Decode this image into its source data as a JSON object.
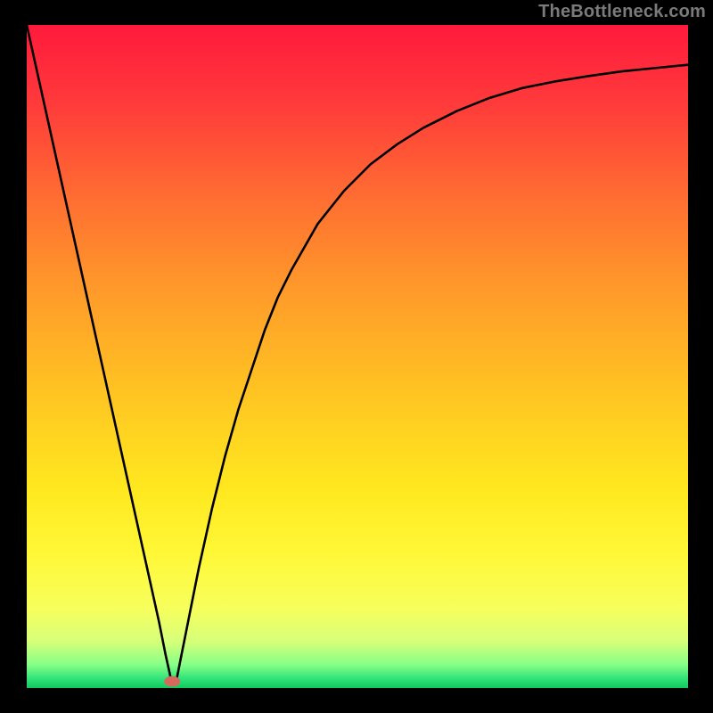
{
  "watermark": "TheBottleneck.com",
  "chart_data": {
    "type": "line",
    "title": "",
    "xlabel": "",
    "ylabel": "",
    "xlim": [
      0,
      100
    ],
    "ylim": [
      0,
      100
    ],
    "marker": {
      "x": 22,
      "y": 1.0
    },
    "curve": [
      {
        "x": 0,
        "y": 100
      },
      {
        "x": 2,
        "y": 91
      },
      {
        "x": 4,
        "y": 82
      },
      {
        "x": 6,
        "y": 73
      },
      {
        "x": 8,
        "y": 64
      },
      {
        "x": 10,
        "y": 55
      },
      {
        "x": 12,
        "y": 46
      },
      {
        "x": 14,
        "y": 37
      },
      {
        "x": 16,
        "y": 28
      },
      {
        "x": 18,
        "y": 19
      },
      {
        "x": 20,
        "y": 10
      },
      {
        "x": 21,
        "y": 5
      },
      {
        "x": 22,
        "y": 0.5
      },
      {
        "x": 22.5,
        "y": 0.5
      },
      {
        "x": 23,
        "y": 3
      },
      {
        "x": 24,
        "y": 8
      },
      {
        "x": 25,
        "y": 13
      },
      {
        "x": 26,
        "y": 18
      },
      {
        "x": 28,
        "y": 27
      },
      {
        "x": 30,
        "y": 35
      },
      {
        "x": 32,
        "y": 42
      },
      {
        "x": 34,
        "y": 48
      },
      {
        "x": 36,
        "y": 54
      },
      {
        "x": 38,
        "y": 59
      },
      {
        "x": 40,
        "y": 63
      },
      {
        "x": 44,
        "y": 70
      },
      {
        "x": 48,
        "y": 75
      },
      {
        "x": 52,
        "y": 79
      },
      {
        "x": 56,
        "y": 82
      },
      {
        "x": 60,
        "y": 84.5
      },
      {
        "x": 65,
        "y": 87
      },
      {
        "x": 70,
        "y": 89
      },
      {
        "x": 75,
        "y": 90.5
      },
      {
        "x": 80,
        "y": 91.5
      },
      {
        "x": 85,
        "y": 92.3
      },
      {
        "x": 90,
        "y": 93
      },
      {
        "x": 95,
        "y": 93.5
      },
      {
        "x": 100,
        "y": 94
      }
    ],
    "gradient_stops": [
      {
        "offset": 0.0,
        "color": "#ff1a3c"
      },
      {
        "offset": 0.12,
        "color": "#ff3b3b"
      },
      {
        "offset": 0.25,
        "color": "#ff6a32"
      },
      {
        "offset": 0.4,
        "color": "#ff9a2a"
      },
      {
        "offset": 0.55,
        "color": "#ffc322"
      },
      {
        "offset": 0.7,
        "color": "#ffe81f"
      },
      {
        "offset": 0.8,
        "color": "#fff838"
      },
      {
        "offset": 0.88,
        "color": "#f7ff5c"
      },
      {
        "offset": 0.93,
        "color": "#d6ff7a"
      },
      {
        "offset": 0.965,
        "color": "#86ff86"
      },
      {
        "offset": 0.985,
        "color": "#33e47a"
      },
      {
        "offset": 1.0,
        "color": "#10c95f"
      }
    ],
    "marker_color": "#d46a5e",
    "curve_color": "#000000",
    "curve_width": 2.6
  }
}
